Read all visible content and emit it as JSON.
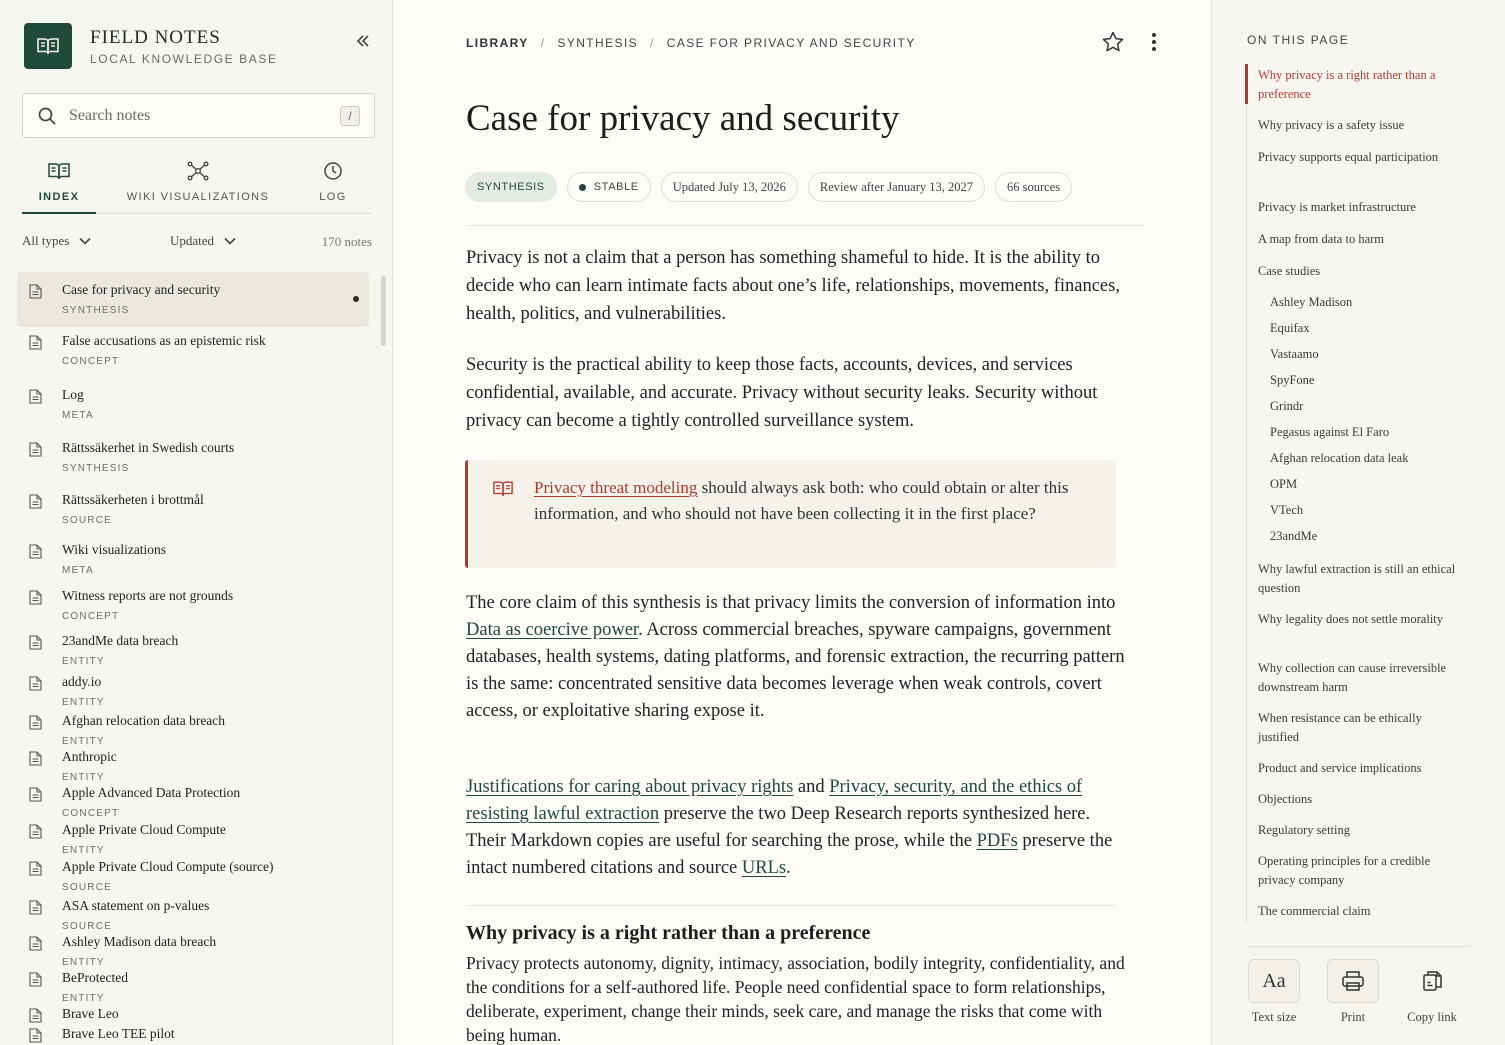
{
  "brand": {
    "title": "FIELD NOTES",
    "subtitle": "LOCAL KNOWLEDGE BASE"
  },
  "search": {
    "placeholder": "Search notes",
    "shortcut": "/"
  },
  "tabs": [
    {
      "label": "INDEX",
      "icon": "book-open-icon",
      "active": true
    },
    {
      "label": "WIKI VISUALIZATIONS",
      "icon": "graph-nodes-icon",
      "active": false
    },
    {
      "label": "LOG",
      "icon": "clock-icon",
      "active": false
    }
  ],
  "filters": {
    "type": "All types",
    "sort": "Updated",
    "count": "170 notes"
  },
  "notes": [
    {
      "title": "Case for privacy and security",
      "type": "SYNTHESIS",
      "active": true
    },
    {
      "title": "False accusations as an epistemic risk",
      "type": "CONCEPT"
    },
    {
      "title": "Log",
      "type": "META"
    },
    {
      "title": "Rättssäkerhet in Swedish courts",
      "type": "SYNTHESIS"
    },
    {
      "title": "Rättssäkerheten i brottmål",
      "type": "SOURCE"
    },
    {
      "title": "Wiki visualizations",
      "type": "META"
    },
    {
      "title": "Witness reports are not grounds",
      "type": "CONCEPT"
    },
    {
      "title": "23andMe data breach",
      "type": "ENTITY"
    },
    {
      "title": "addy.io",
      "type": "ENTITY"
    },
    {
      "title": "Afghan relocation data breach",
      "type": "ENTITY"
    },
    {
      "title": "Anthropic",
      "type": "ENTITY"
    },
    {
      "title": "Apple Advanced Data Protection",
      "type": "CONCEPT"
    },
    {
      "title": "Apple Private Cloud Compute",
      "type": "ENTITY"
    },
    {
      "title": "Apple Private Cloud Compute (source)",
      "type": "SOURCE"
    },
    {
      "title": "ASA statement on p-values",
      "type": "SOURCE"
    },
    {
      "title": "Ashley Madison data breach",
      "type": "ENTITY"
    },
    {
      "title": "BeProtected",
      "type": "ENTITY"
    },
    {
      "title": "Brave Leo",
      "type": ""
    },
    {
      "title": "Brave Leo TEE pilot",
      "type": ""
    }
  ],
  "breadcrumb": {
    "root": "LIBRARY",
    "middle": "SYNTHESIS",
    "current": "CASE FOR PRIVACY AND SECURITY"
  },
  "page": {
    "title": "Case for privacy and security",
    "chips": {
      "type": "SYNTHESIS",
      "status": "STABLE",
      "updated": "Updated July 13, 2026",
      "review": "Review after January 13, 2027",
      "sources": "66 sources"
    },
    "p1": "Privacy is not a claim that a person has something shameful to hide. It is the ability to decide who can learn intimate facts about one’s life, relationships, movements, finances, health, politics, and vulnerabilities.",
    "p2": "Security is the practical ability to keep those facts, accounts, devices, and services confidential, available, and accurate. Privacy without security leaks. Security without privacy can become a tightly controlled surveillance system.",
    "callout": {
      "link": "Privacy threat modeling",
      "text": " should always ask both: who could obtain or alter this information, and who should not have been collecting it in the first place?"
    },
    "p3": {
      "a": "The core claim of this synthesis is that privacy limits the conversion of information into ",
      "link": "Data as coercive power",
      "b": ". Across commercial breaches, spyware campaigns, government databases, health systems, dating platforms, and forensic extraction, the recurring pattern is the same: concentrated sensitive data becomes leverage when weak controls, covert access, or exploitative sharing expose it."
    },
    "p4": {
      "link1": "Justifications for caring about privacy rights",
      "and": " and ",
      "link2": "Privacy, security, and the ethics of resisting lawful extraction",
      "a": " preserve the two Deep Research reports synthesized here. Their Markdown copies are useful for searching the prose, while the ",
      "link3": "PDFs",
      "b": " preserve the intact numbered citations and source ",
      "link4": "URLs",
      "c": "."
    },
    "section_heading": "Why privacy is a right rather than a preference",
    "section_text": "Privacy protects autonomy, dignity, intimacy, association, bodily integrity, confidentiality, and the conditions for a self-authored life. People need confidential space to form relationships, deliberate, experiment, change their minds, seek care, and manage the risks that come with being human."
  },
  "toc": {
    "title": "ON THIS PAGE",
    "items": [
      {
        "label": "Why privacy is a right rather than a preference",
        "active": true
      },
      {
        "label": "Why privacy is a safety issue"
      },
      {
        "label": "Privacy supports equal participation"
      },
      {
        "label": "Privacy is market infrastructure"
      },
      {
        "label": "A map from data to harm"
      },
      {
        "label": "Case studies"
      },
      {
        "label": "Ashley Madison",
        "sub": true
      },
      {
        "label": "Equifax",
        "sub": true
      },
      {
        "label": "Vastaamo",
        "sub": true
      },
      {
        "label": "SpyFone",
        "sub": true
      },
      {
        "label": "Grindr",
        "sub": true
      },
      {
        "label": "Pegasus against El Faro",
        "sub": true
      },
      {
        "label": "Afghan relocation data leak",
        "sub": true
      },
      {
        "label": "OPM",
        "sub": true
      },
      {
        "label": "VTech",
        "sub": true
      },
      {
        "label": "23andMe",
        "sub": true
      },
      {
        "label": "Why lawful extraction is still an ethical question"
      },
      {
        "label": "Why legality does not settle morality"
      },
      {
        "label": "Why collection can cause irreversible downstream harm"
      },
      {
        "label": "When resistance can be ethically justified"
      },
      {
        "label": "Product and service implications"
      },
      {
        "label": "Objections"
      },
      {
        "label": "Regulatory setting"
      },
      {
        "label": "Operating principles for a credible privacy company"
      },
      {
        "label": "The commercial claim"
      }
    ]
  },
  "tools": {
    "text_size_glyph": "Aa",
    "text_size": "Text size",
    "print": "Print",
    "copy_link": "Copy link"
  },
  "colors": {
    "brand_green": "#1f4a3b",
    "accent_red": "#b23a2a",
    "background": "#fbfaf7"
  }
}
